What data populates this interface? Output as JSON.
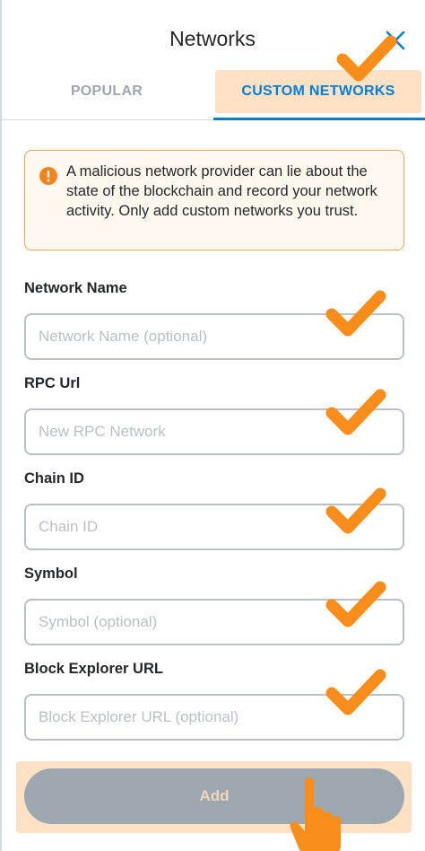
{
  "header": {
    "title": "Networks",
    "close_icon": "close-icon"
  },
  "tabs": [
    {
      "label": "POPULAR",
      "active": false
    },
    {
      "label": "CUSTOM NETWORKS",
      "active": true
    }
  ],
  "warning": {
    "icon": "warning-icon",
    "text": "A malicious network provider can lie about the state of the blockchain and record your network activity. Only add custom networks you trust."
  },
  "fields": [
    {
      "label": "Network Name",
      "placeholder": "Network Name (optional)",
      "value": ""
    },
    {
      "label": "RPC Url",
      "placeholder": "New RPC Network",
      "value": ""
    },
    {
      "label": "Chain ID",
      "placeholder": "Chain ID",
      "value": ""
    },
    {
      "label": "Symbol",
      "placeholder": "Symbol (optional)",
      "value": ""
    },
    {
      "label": "Block Explorer URL",
      "placeholder": "Block Explorer URL (optional)",
      "value": ""
    }
  ],
  "add_button": {
    "label": "Add",
    "enabled": false
  },
  "colors": {
    "accent": "#037dd6",
    "highlight": "#fde1c4",
    "warning_border": "#f0a667",
    "warning_icon": "#f5841f",
    "checkmark": "#f98d1b",
    "button_disabled": "#9ca7b0"
  }
}
